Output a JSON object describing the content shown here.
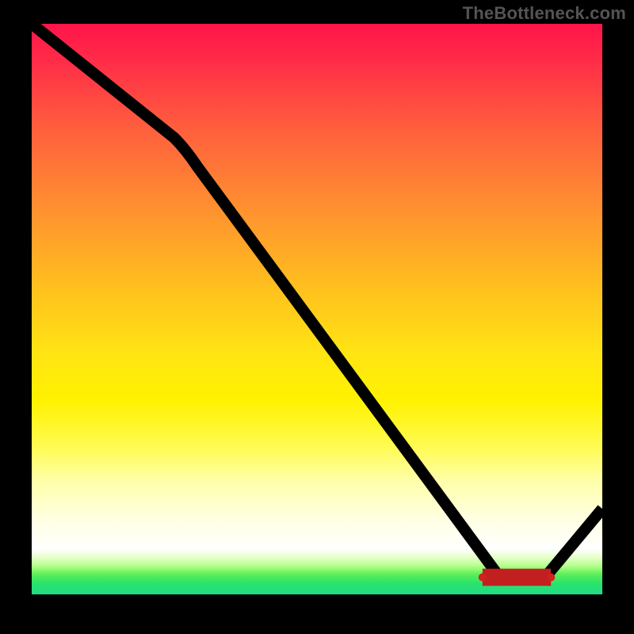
{
  "watermark": "TheBottleneck.com",
  "chart_data": {
    "type": "line",
    "title": "",
    "xlabel": "",
    "ylabel": "",
    "xlim": [
      0,
      100
    ],
    "ylim": [
      0,
      100
    ],
    "series": [
      {
        "name": "bottleneck-curve",
        "x": [
          0,
          25,
          82,
          90,
          100
        ],
        "y": [
          100,
          80,
          3,
          3,
          15
        ]
      }
    ],
    "marker_band": {
      "x_start": 79,
      "x_end": 91,
      "y": 3
    },
    "gradient_colors": {
      "top": "#ff144a",
      "mid": "#ffe513",
      "bottom": "#1edc87"
    }
  }
}
